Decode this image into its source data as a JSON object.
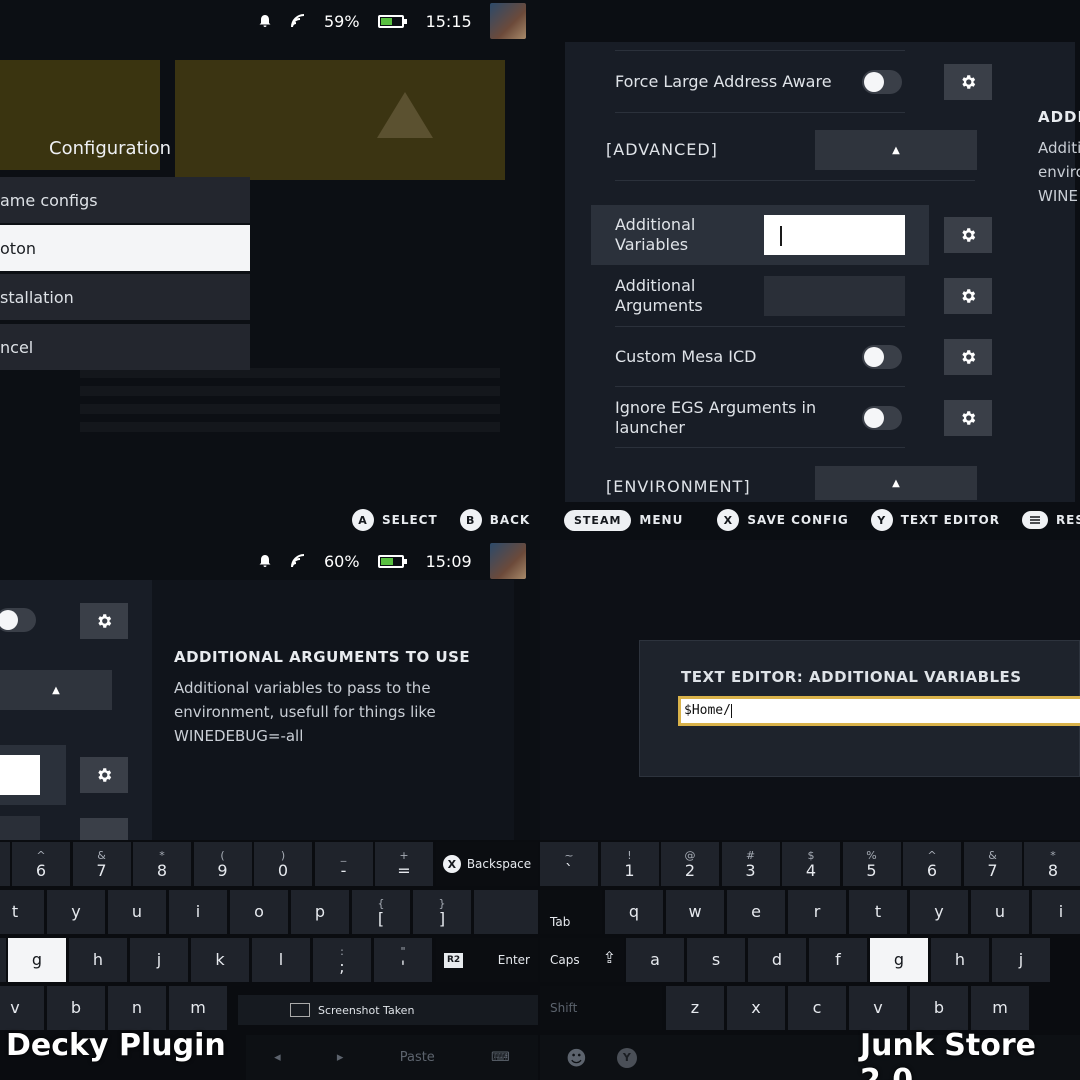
{
  "top_left": {
    "status": {
      "battery": "59%",
      "time": "15:15"
    },
    "battery_level": 0.59,
    "menu_title": "Configuration",
    "menu_items": [
      "ame configs",
      "oton",
      "stallation",
      "ncel"
    ],
    "active_index": 1,
    "footer": {
      "a_label": "SELECT",
      "b_label": "BACK",
      "a_btn": "A",
      "b_btn": "B"
    }
  },
  "top_right": {
    "rows": {
      "force_large": "Force Large Address Aware",
      "advanced": "[ADVANCED]",
      "add_vars": "Additional Variables",
      "add_args": "Additional Arguments",
      "mesa": "Custom Mesa ICD",
      "ignore_egs": "Ignore EGS Arguments in launcher",
      "environment": "[ENVIRONMENT]"
    },
    "side_text": {
      "heading": "ADDITI",
      "line1": "Additi",
      "line2": "enviro",
      "line3": "WINE"
    },
    "footer": {
      "steam": "STEAM",
      "menu": "MENU",
      "x_btn": "X",
      "save": "SAVE CONFIG",
      "y_btn": "Y",
      "text_editor": "TEXT EDITOR",
      "reset": "RESET"
    }
  },
  "bottom_left": {
    "status": {
      "battery": "60%",
      "time": "15:09"
    },
    "battery_level": 0.6,
    "help_title": "ADDITIONAL ARGUMENTS TO USE",
    "help_body_1": "Additional variables to pass to the",
    "help_body_2": "environment, usefull for things like",
    "help_body_3": "WINEDEBUG=-all",
    "overlay_label": "Decky Plugin",
    "screenshot_toast": "Screenshot Taken",
    "paste": "Paste"
  },
  "bottom_right": {
    "editor_title": "TEXT EDITOR: ADDITIONAL VARIABLES",
    "editor_value": "$Home/",
    "overlay_label": "Junk Store 2.0"
  },
  "keyboard_left": {
    "row1": [
      [
        "^",
        "6"
      ],
      [
        "&",
        "7"
      ],
      [
        "*",
        "8"
      ],
      [
        "(",
        "9"
      ],
      [
        ")",
        "0"
      ],
      [
        "_",
        "-"
      ],
      [
        "+",
        "="
      ]
    ],
    "backspace": "Backspace",
    "x_btn": "X",
    "row2": [
      [
        "",
        "t"
      ],
      [
        "",
        "y"
      ],
      [
        "",
        "u"
      ],
      [
        "",
        "i"
      ],
      [
        "",
        "o"
      ],
      [
        "",
        "p"
      ],
      [
        "{",
        "["
      ],
      [
        "}",
        "]"
      ],
      [
        "|",
        "\\"
      ]
    ],
    "row3": [
      [
        "",
        "g"
      ],
      [
        "",
        "h"
      ],
      [
        "",
        "j"
      ],
      [
        "",
        "k"
      ],
      [
        "",
        "l"
      ],
      [
        ":",
        ";"
      ],
      [
        "\"",
        "'"
      ]
    ],
    "enter": "Enter",
    "r2": "R2",
    "row4": [
      "v",
      "b",
      "n",
      "m"
    ]
  },
  "keyboard_right": {
    "row1": [
      [
        "~",
        "`"
      ],
      [
        "!",
        "1"
      ],
      [
        "@",
        "2"
      ],
      [
        "#",
        "3"
      ],
      [
        "$",
        "4"
      ],
      [
        "%",
        "5"
      ],
      [
        "^",
        "6"
      ],
      [
        "&",
        "7"
      ],
      [
        "*",
        "8"
      ]
    ],
    "tab": "Tab",
    "row2": [
      "q",
      "w",
      "e",
      "r",
      "t",
      "y",
      "u",
      "i"
    ],
    "caps": "Caps",
    "row3": [
      "a",
      "s",
      "d",
      "f",
      "g",
      "h",
      "j"
    ],
    "shift": "Shift",
    "row4": [
      "z",
      "x",
      "c",
      "v",
      "b",
      "m"
    ],
    "y_btn": "Y"
  }
}
